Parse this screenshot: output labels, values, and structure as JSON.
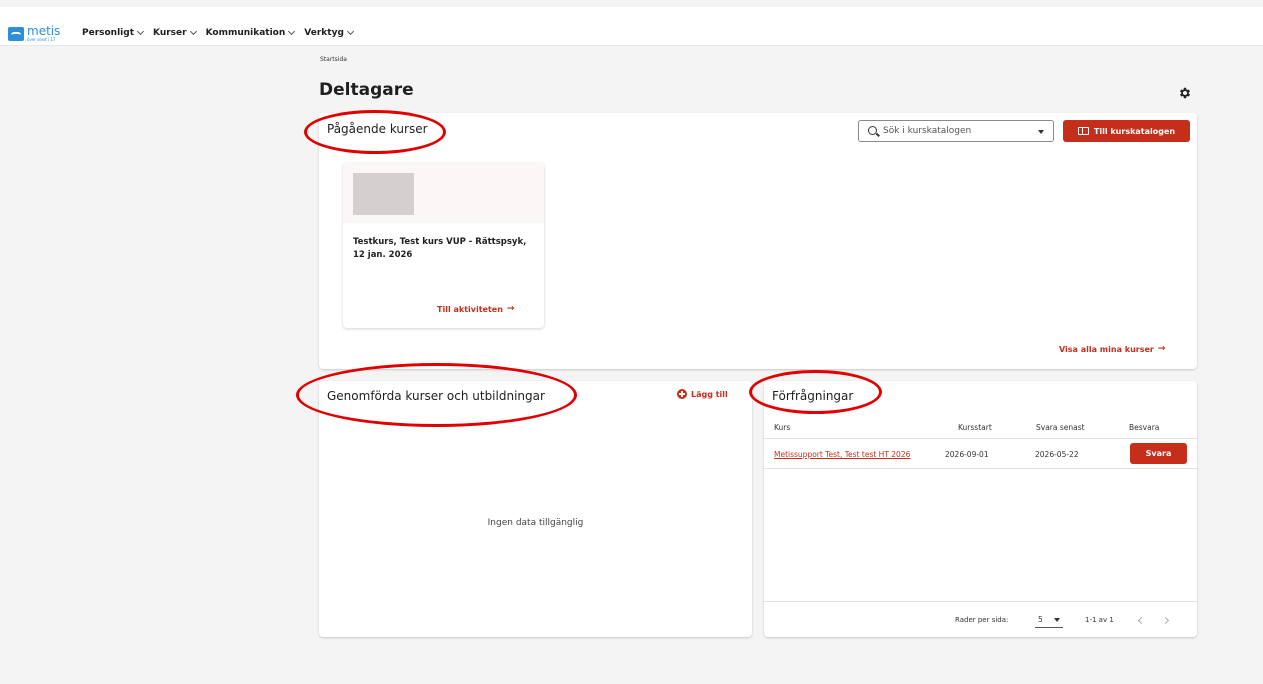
{
  "header": {
    "logo_text": "metis",
    "logo_sub": "över sexit i 17",
    "nav": [
      {
        "label": "Personligt"
      },
      {
        "label": "Kurser"
      },
      {
        "label": "Kommunikation"
      },
      {
        "label": "Verktyg"
      }
    ]
  },
  "breadcrumb": "Startsida",
  "page_title": "Deltagare",
  "ongoing": {
    "title": "Pågående kurser",
    "search_placeholder": "Sök i kurskatalogen",
    "catalog_button": "Till kurskatalogen",
    "course": {
      "name": "Testkurs, Test kurs VUP - Rättspsyk, 12 jan. 2026",
      "link": "Till aktiviteten"
    },
    "show_all": "Visa alla mina kurser"
  },
  "completed": {
    "title": "Genomförda kurser och utbildningar",
    "add_label": "Lägg till",
    "no_data": "Ingen data tillgänglig"
  },
  "requests": {
    "title": "Förfrågningar",
    "columns": [
      "Kurs",
      "Kursstart",
      "Svara senast",
      "Besvara"
    ],
    "rows": [
      {
        "course": "Metissupport Test, Test test HT 2026",
        "start": "2026-09-01",
        "deadline": "2026-05-22",
        "action": "Svara"
      }
    ],
    "pager": {
      "rows_label": "Rader per sida:",
      "rows_value": "5",
      "range": "1-1 av 1"
    }
  },
  "colors": {
    "accent": "#c62e1c",
    "brand": "#2d8fd6",
    "highlight": "#e10000"
  },
  "icons": [
    "search-icon",
    "book-icon",
    "gear-icon",
    "plus-circle-icon",
    "arrow-right-icon",
    "chevron-down-icon"
  ]
}
